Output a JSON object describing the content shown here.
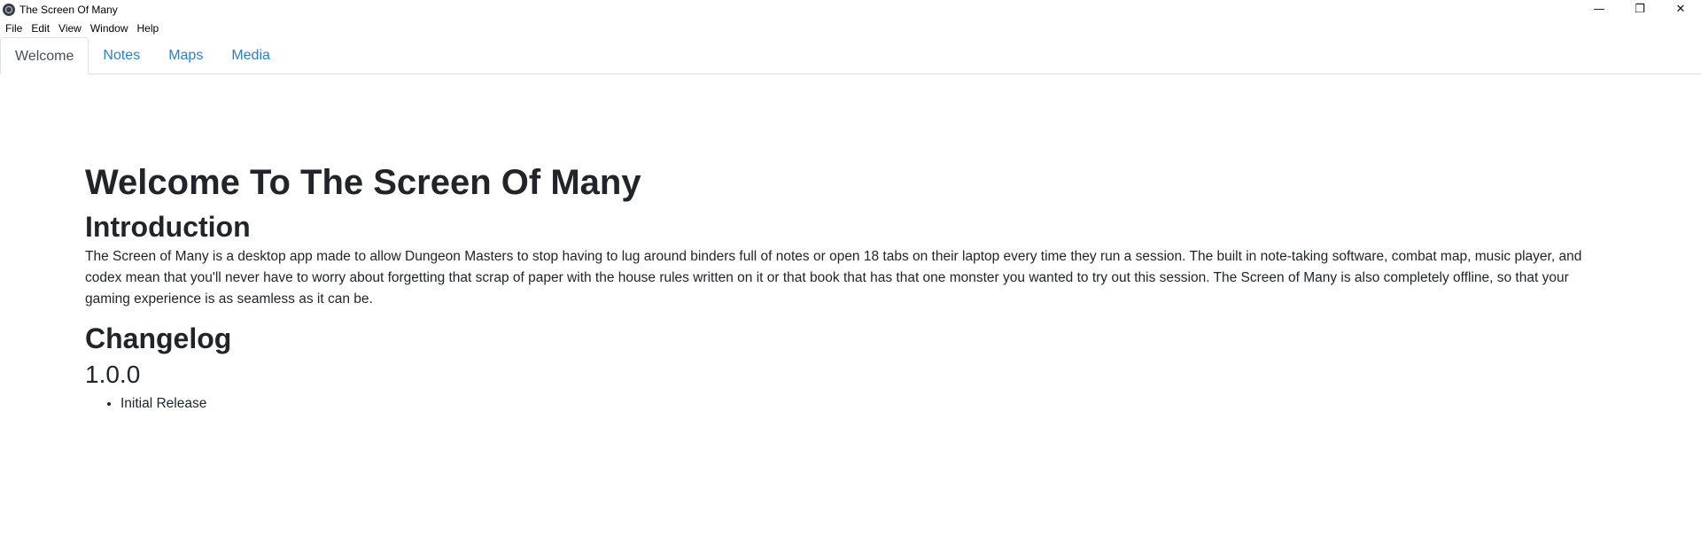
{
  "window": {
    "title": "The Screen Of Many",
    "minimize_glyph": "—",
    "restore_glyph": "❐",
    "close_glyph": "✕"
  },
  "menu": [
    "File",
    "Edit",
    "View",
    "Window",
    "Help"
  ],
  "tabs": [
    "Welcome",
    "Notes",
    "Maps",
    "Media"
  ],
  "active_tab": "Welcome",
  "content": {
    "heading": "Welcome To The Screen Of Many",
    "intro_heading": "Introduction",
    "intro_text": "The Screen of Many is a desktop app made to allow Dungeon Masters to stop having to lug around binders full of notes or open 18 tabs on their laptop every time they run a session. The built in note-taking software, combat map, music player, and codex mean that you'll never have to worry about forgetting that scrap of paper with the house rules written on it or that book that has that one monster you wanted to try out this session. The Screen of Many is also completely offline, so that your gaming experience is as seamless as it can be.",
    "changelog_heading": "Changelog",
    "version": "1.0.0",
    "changes": [
      "Initial Release"
    ]
  },
  "colors": {
    "link": "#2a7ed8",
    "text": "#212529",
    "tab_border": "#dee2e6"
  }
}
